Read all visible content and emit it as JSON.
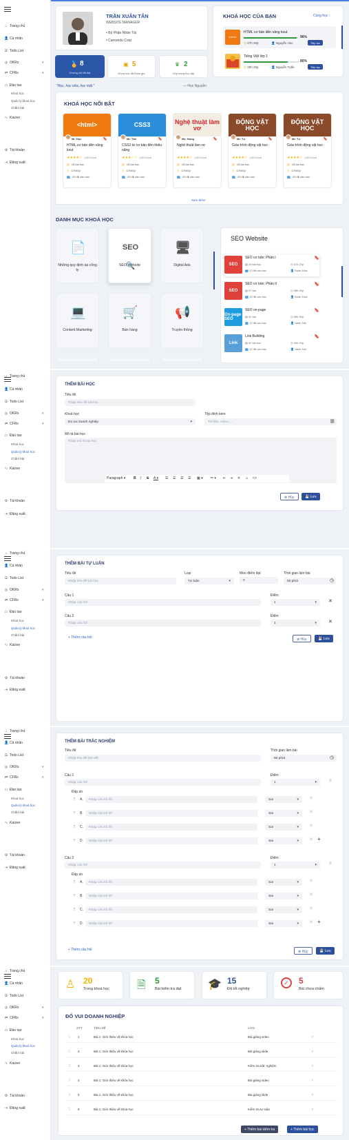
{
  "nav": {
    "home": "Trang chủ",
    "personal": "Cá nhân",
    "todo": "Todo List",
    "okrs": "OKRs",
    "cfrs": "CFRs",
    "training": "Đào tạo",
    "training_sub": [
      "Khoá học",
      "Quản lý khoá học",
      "Chấm bài"
    ],
    "kaizen": "Kaizen",
    "account": "Tài khoản",
    "logout": "Đăng xuất"
  },
  "profile": {
    "name": "TRẦN XUÂN TÂN",
    "role": "WEBSITE MANAGER",
    "dept": "Bộ Phận Nhân Tài",
    "company": "Camondo Corp"
  },
  "stats": [
    {
      "value": "8",
      "label": "Chứng chỉ đã đạt"
    },
    {
      "value": "5",
      "label": "Khoá học đã tham gia"
    },
    {
      "value": "2",
      "label": "Xếp hạng học tập"
    }
  ],
  "quote": {
    "text": "\"Học, học nữa, học mãi.\"",
    "author": "— Học Nguyễn"
  },
  "my_courses": {
    "title": "KHOÁ HỌC CỦA BẠN",
    "link": "Cùng học",
    "items": [
      {
        "name": "HTML cơ bản đến nâng kout",
        "pct": "96%",
        "time": "07h 30p",
        "author": "Nguyễn Học",
        "btn": "Tiếp tục"
      },
      {
        "name": "Tiếng Việt lớp 1",
        "pct": "80%",
        "time": "20h 20p",
        "author": "Nguyễn Tuấn",
        "btn": "Tiếp tục"
      }
    ]
  },
  "featured": {
    "title": "KHOÁ HỌC NỔI BẬT",
    "more": "Xem thêm",
    "items": [
      {
        "img": "<html>",
        "author": "Mr. Học",
        "title": "HTML cơ bản đến nâng kout",
        "stars": "★★★★☆",
        "rc": "(150 lượt)",
        "lessons": "15 bài học",
        "time": "07h30p",
        "students": "93 đã vào học"
      },
      {
        "img": "CSS3",
        "author": "Mr. Tân",
        "title": "CSS3 từ cơ bản đến thiêu năng",
        "stars": "★★★☆☆",
        "rc": "(150 lượt)",
        "lessons": "15 bài học",
        "time": "07h30p",
        "students": "93 đã vào học"
      },
      {
        "img": "Nghệ thuật làm vơ",
        "author": "Ms. Hùng",
        "title": "Nghệ thuật làm vợ",
        "stars": "★★★★☆",
        "rc": "(150 lượt)",
        "lessons": "15 bài học",
        "time": "07h30p",
        "students": "93 đã vào học"
      },
      {
        "img": "ĐỘNG VẬT HỌC",
        "author": "Mr. Tứ",
        "title": "Giáo trình động vật học",
        "stars": "★★★★☆",
        "rc": "(150 lượt)",
        "lessons": "15 bài học",
        "time": "07h30p",
        "students": "93 đã vào học"
      },
      {
        "img": "ĐỘNG VẬT HỌC",
        "author": "Mr. Tứ",
        "title": "Giáo trình động vật học",
        "stars": "★★★★☆",
        "rc": "(150 lượt)",
        "lessons": "15 bài học",
        "time": "07h30p",
        "students": "93 đã vào học"
      }
    ]
  },
  "categories": {
    "title": "DANH MỤC KHOÁ HỌC",
    "items": [
      "Những quy định tại công ty",
      "SEO Website",
      "Digital Ads",
      "Content Marketing",
      "Bán hàng",
      "Truyền thông"
    ]
  },
  "seo": {
    "title": "SEO Website",
    "items": [
      {
        "thumb": "SEO",
        "name": "SEO cơ bản: Phần I",
        "lessons": "10 bài học",
        "time": "07h 20p",
        "students": "12 đã vào học",
        "author": "Đoàn Hòa"
      },
      {
        "thumb": "SEO",
        "name": "SEO cơ bản: Phần II",
        "lessons": "07 bài",
        "time": "08h 30p",
        "students": "15 đã vào học",
        "author": "Đoàn Hòa"
      },
      {
        "thumb": "On-page SEO",
        "name": "SEO on-page",
        "lessons": "02 bài",
        "time": "05h 30p",
        "students": "12 đã vào học",
        "author": "Hạnh Nhi"
      },
      {
        "thumb": "Link",
        "name": "Link Building",
        "lessons": "02 bài học",
        "time": "03h 20p",
        "students": "12 đã vào học",
        "author": "Hạnh Nhi"
      }
    ]
  },
  "add_lesson": {
    "title": "THÊM BÀI HỌC",
    "f_title": "Tiêu đề",
    "ph_title": "Nhập tiêu đề bài học",
    "f_course": "Khoá học",
    "course_val": "Đo sui doanh nghiệp",
    "f_file": "Tệp đính kèm",
    "ph_file": "Tài liệu, video, ...",
    "f_desc": "Mô tả bài học",
    "ph_desc": "Nhập mô tả bài học",
    "para": "Paragraph",
    "cancel": "Hủy",
    "save": "Lưu"
  },
  "essay": {
    "title": "THÊM BÀI TỰ LUẬN",
    "f_title": "Tiêu đề",
    "ph_title": "Nhập tiêu đề bài học",
    "f_type": "Loại",
    "type_val": "Tự luận",
    "f_score": "Mức điểm đạt",
    "score_val": "0",
    "f_time": "Thời gian làm bài",
    "time_val": "60 phút",
    "q1": "Câu 1",
    "q2": "Câu 2",
    "ph_q": "Nhập câu hỏi",
    "f_point": "Điểm",
    "point_val": "1",
    "add": "Thêm câu hỏi",
    "cancel": "Hủy",
    "save": "Lưu"
  },
  "quiz": {
    "title": "THÊM BÀI TRẮC NGHIỆM",
    "f_title": "Tiêu đề",
    "ph_title": "Nhập tiêu đề bài viết",
    "f_time": "Thời gian làm bài",
    "time_val": "60 phút",
    "q1": "Câu 1",
    "q2": "Câu 2",
    "ph_q": "Nhập câu hỏi",
    "f_point": "Điểm",
    "point_val": "1",
    "ans": "Đáp án",
    "opts": [
      "A.",
      "B.",
      "C.",
      "D."
    ],
    "ph_ans": "Nhập câu trả lời",
    "wrong": "Sai",
    "add": "Thêm câu hỏi",
    "cancel": "Hủy",
    "save": "Lưu"
  },
  "summary": {
    "stats": [
      {
        "v": "20",
        "l": "Trong khoá học"
      },
      {
        "v": "5",
        "l": "Bài kiểm tra đạt"
      },
      {
        "v": "15",
        "l": "Đã tốt nghiệp"
      },
      {
        "v": "5",
        "l": "Bài chưa chấm"
      }
    ],
    "title": "ĐỐ VUI DOANH NGHIỆP",
    "cols": [
      "STT",
      "TIÊU ĐỀ",
      "LOẠI"
    ],
    "rows": [
      {
        "n": "1",
        "t": "Bài 1: Giới thiệu về khóa học",
        "k": "Bài giảng video"
      },
      {
        "n": "2",
        "t": "Bài 1: Giới thiệu về khóa học",
        "k": "Bài giảng slide"
      },
      {
        "n": "3",
        "t": "Bài 1: Giới thiệu về khóa học",
        "k": "Kiểm tra trắc nghiệm"
      },
      {
        "n": "4",
        "t": "Bài 1: Giới thiệu về khóa học",
        "k": "Bài giảng video"
      },
      {
        "n": "5",
        "t": "Bài 1: Giới thiệu về khóa học",
        "k": "Bài giảng slide"
      },
      {
        "n": "6",
        "t": "Bài 1: Giới thiệu về khóa học",
        "k": "Kiểm tra tự luận"
      }
    ],
    "add_test": "Thêm bài kiểm tra",
    "add_lesson": "Thêm bài học"
  }
}
